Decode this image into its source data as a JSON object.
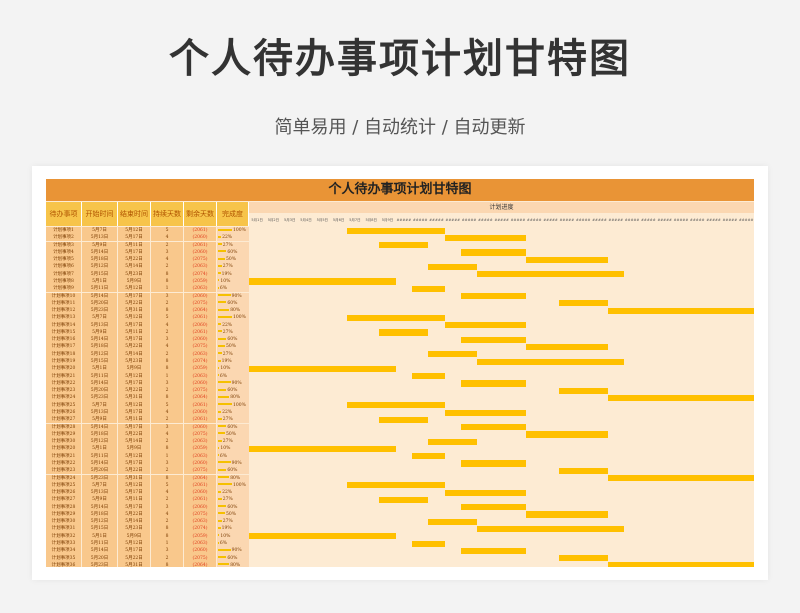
{
  "page": {
    "title": "个人待办事项计划甘特图",
    "subtitle": "简单易用 / 自动统计 / 自动更新"
  },
  "sheet": {
    "title": "个人待办事项计划甘特图",
    "headers": [
      "待办事项",
      "开始时间",
      "结束时间",
      "持续天数",
      "剩余天数",
      "完成度"
    ],
    "plan_header": "计划进度",
    "dates_visible": [
      "5月1日",
      "5月2日",
      "5月3日",
      "5月4日",
      "5月5日",
      "5月6日",
      "5月7日",
      "5月8日",
      "5月9日"
    ]
  },
  "rows": [
    {
      "name": "计划事项1",
      "start": "5月7日",
      "end": "5月12日",
      "dur": "5",
      "remain": "(2061)",
      "pct": "100%",
      "bar_start": 7,
      "bar_days": 6
    },
    {
      "name": "计划事项2",
      "start": "5月13日",
      "end": "5月17日",
      "dur": "4",
      "remain": "(2060)",
      "pct": "22%",
      "bar_start": 13,
      "bar_days": 5
    },
    {
      "name": "计划事项3",
      "start": "5月9日",
      "end": "5月11日",
      "dur": "2",
      "remain": "(2061)",
      "pct": "27%",
      "bar_start": 9,
      "bar_days": 3
    },
    {
      "name": "计划事项4",
      "start": "5月14日",
      "end": "5月17日",
      "dur": "3",
      "remain": "(2060)",
      "pct": "60%",
      "bar_start": 14,
      "bar_days": 4
    },
    {
      "name": "计划事项5",
      "start": "5月18日",
      "end": "5月22日",
      "dur": "4",
      "remain": "(2075)",
      "pct": "50%",
      "bar_start": 18,
      "bar_days": 5
    },
    {
      "name": "计划事项6",
      "start": "5月12日",
      "end": "5月14日",
      "dur": "2",
      "remain": "(2063)",
      "pct": "27%",
      "bar_start": 12,
      "bar_days": 3
    },
    {
      "name": "计划事项7",
      "start": "5月15日",
      "end": "5月23日",
      "dur": "8",
      "remain": "(2074)",
      "pct": "19%",
      "bar_start": 15,
      "bar_days": 9
    },
    {
      "name": "计划事项8",
      "start": "5月1日",
      "end": "5月9日",
      "dur": "8",
      "remain": "(2059)",
      "pct": "10%",
      "bar_start": 1,
      "bar_days": 9
    },
    {
      "name": "计划事项9",
      "start": "5月11日",
      "end": "5月12日",
      "dur": "1",
      "remain": "(2063)",
      "pct": "6%",
      "bar_start": 11,
      "bar_days": 2
    },
    {
      "name": "计划事项10",
      "start": "5月14日",
      "end": "5月17日",
      "dur": "3",
      "remain": "(2060)",
      "pct": "90%",
      "bar_start": 14,
      "bar_days": 4
    },
    {
      "name": "计划事项11",
      "start": "5月20日",
      "end": "5月22日",
      "dur": "2",
      "remain": "(2075)",
      "pct": "60%",
      "bar_start": 20,
      "bar_days": 3
    },
    {
      "name": "计划事项12",
      "start": "5月23日",
      "end": "5月31日",
      "dur": "8",
      "remain": "(2064)",
      "pct": "80%",
      "bar_start": 23,
      "bar_days": 9
    },
    {
      "name": "计划事项13",
      "start": "5月7日",
      "end": "5月12日",
      "dur": "5",
      "remain": "(2061)",
      "pct": "100%",
      "bar_start": 7,
      "bar_days": 6
    },
    {
      "name": "计划事项14",
      "start": "5月13日",
      "end": "5月17日",
      "dur": "4",
      "remain": "(2060)",
      "pct": "22%",
      "bar_start": 13,
      "bar_days": 5
    },
    {
      "name": "计划事项15",
      "start": "5月9日",
      "end": "5月11日",
      "dur": "2",
      "remain": "(2061)",
      "pct": "27%",
      "bar_start": 9,
      "bar_days": 3
    },
    {
      "name": "计划事项16",
      "start": "5月14日",
      "end": "5月17日",
      "dur": "3",
      "remain": "(2060)",
      "pct": "60%",
      "bar_start": 14,
      "bar_days": 4
    },
    {
      "name": "计划事项17",
      "start": "5月18日",
      "end": "5月22日",
      "dur": "4",
      "remain": "(2075)",
      "pct": "50%",
      "bar_start": 18,
      "bar_days": 5
    },
    {
      "name": "计划事项18",
      "start": "5月12日",
      "end": "5月14日",
      "dur": "2",
      "remain": "(2063)",
      "pct": "27%",
      "bar_start": 12,
      "bar_days": 3
    },
    {
      "name": "计划事项19",
      "start": "5月15日",
      "end": "5月23日",
      "dur": "8",
      "remain": "(2074)",
      "pct": "19%",
      "bar_start": 15,
      "bar_days": 9
    },
    {
      "name": "计划事项20",
      "start": "5月1日",
      "end": "5月9日",
      "dur": "8",
      "remain": "(2059)",
      "pct": "10%",
      "bar_start": 1,
      "bar_days": 9
    },
    {
      "name": "计划事项21",
      "start": "5月11日",
      "end": "5月12日",
      "dur": "1",
      "remain": "(2063)",
      "pct": "6%",
      "bar_start": 11,
      "bar_days": 2
    },
    {
      "name": "计划事项22",
      "start": "5月14日",
      "end": "5月17日",
      "dur": "3",
      "remain": "(2060)",
      "pct": "90%",
      "bar_start": 14,
      "bar_days": 4
    },
    {
      "name": "计划事项23",
      "start": "5月20日",
      "end": "5月22日",
      "dur": "2",
      "remain": "(2075)",
      "pct": "60%",
      "bar_start": 20,
      "bar_days": 3
    },
    {
      "name": "计划事项24",
      "start": "5月23日",
      "end": "5月31日",
      "dur": "8",
      "remain": "(2064)",
      "pct": "80%",
      "bar_start": 23,
      "bar_days": 9
    },
    {
      "name": "计划事项25",
      "start": "5月7日",
      "end": "5月12日",
      "dur": "5",
      "remain": "(2061)",
      "pct": "100%",
      "bar_start": 7,
      "bar_days": 6
    },
    {
      "name": "计划事项26",
      "start": "5月13日",
      "end": "5月17日",
      "dur": "4",
      "remain": "(2060)",
      "pct": "22%",
      "bar_start": 13,
      "bar_days": 5
    },
    {
      "name": "计划事项27",
      "start": "5月9日",
      "end": "5月11日",
      "dur": "2",
      "remain": "(2061)",
      "pct": "27%",
      "bar_start": 9,
      "bar_days": 3
    },
    {
      "name": "计划事项28",
      "start": "5月14日",
      "end": "5月17日",
      "dur": "3",
      "remain": "(2060)",
      "pct": "60%",
      "bar_start": 14,
      "bar_days": 4
    },
    {
      "name": "计划事项29",
      "start": "5月18日",
      "end": "5月22日",
      "dur": "4",
      "remain": "(2075)",
      "pct": "50%",
      "bar_start": 18,
      "bar_days": 5
    },
    {
      "name": "计划事项30",
      "start": "5月12日",
      "end": "5月14日",
      "dur": "2",
      "remain": "(2063)",
      "pct": "27%",
      "bar_start": 12,
      "bar_days": 3
    },
    {
      "name": "计划事项20",
      "start": "5月1日",
      "end": "5月9日",
      "dur": "8",
      "remain": "(2059)",
      "pct": "10%",
      "bar_start": 1,
      "bar_days": 9
    },
    {
      "name": "计划事项21",
      "start": "5月11日",
      "end": "5月12日",
      "dur": "1",
      "remain": "(2063)",
      "pct": "6%",
      "bar_start": 11,
      "bar_days": 2
    },
    {
      "name": "计划事项22",
      "start": "5月14日",
      "end": "5月17日",
      "dur": "3",
      "remain": "(2060)",
      "pct": "90%",
      "bar_start": 14,
      "bar_days": 4
    },
    {
      "name": "计划事项23",
      "start": "5月20日",
      "end": "5月22日",
      "dur": "2",
      "remain": "(2075)",
      "pct": "60%",
      "bar_start": 20,
      "bar_days": 3
    },
    {
      "name": "计划事项24",
      "start": "5月23日",
      "end": "5月31日",
      "dur": "8",
      "remain": "(2064)",
      "pct": "80%",
      "bar_start": 23,
      "bar_days": 9
    },
    {
      "name": "计划事项25",
      "start": "5月7日",
      "end": "5月12日",
      "dur": "5",
      "remain": "(2061)",
      "pct": "100%",
      "bar_start": 7,
      "bar_days": 6
    },
    {
      "name": "计划事项26",
      "start": "5月13日",
      "end": "5月17日",
      "dur": "4",
      "remain": "(2060)",
      "pct": "22%",
      "bar_start": 13,
      "bar_days": 5
    },
    {
      "name": "计划事项27",
      "start": "5月9日",
      "end": "5月11日",
      "dur": "2",
      "remain": "(2061)",
      "pct": "27%",
      "bar_start": 9,
      "bar_days": 3
    },
    {
      "name": "计划事项28",
      "start": "5月14日",
      "end": "5月17日",
      "dur": "3",
      "remain": "(2060)",
      "pct": "60%",
      "bar_start": 14,
      "bar_days": 4
    },
    {
      "name": "计划事项29",
      "start": "5月18日",
      "end": "5月22日",
      "dur": "4",
      "remain": "(2075)",
      "pct": "50%",
      "bar_start": 18,
      "bar_days": 5
    },
    {
      "name": "计划事项30",
      "start": "5月12日",
      "end": "5月14日",
      "dur": "2",
      "remain": "(2063)",
      "pct": "27%",
      "bar_start": 12,
      "bar_days": 3
    },
    {
      "name": "计划事项31",
      "start": "5月15日",
      "end": "5月23日",
      "dur": "8",
      "remain": "(2074)",
      "pct": "19%",
      "bar_start": 15,
      "bar_days": 9
    },
    {
      "name": "计划事项32",
      "start": "5月1日",
      "end": "5月9日",
      "dur": "8",
      "remain": "(2059)",
      "pct": "10%",
      "bar_start": 1,
      "bar_days": 9
    },
    {
      "name": "计划事项33",
      "start": "5月11日",
      "end": "5月12日",
      "dur": "1",
      "remain": "(2063)",
      "pct": "6%",
      "bar_start": 11,
      "bar_days": 2
    },
    {
      "name": "计划事项34",
      "start": "5月14日",
      "end": "5月17日",
      "dur": "3",
      "remain": "(2060)",
      "pct": "90%",
      "bar_start": 14,
      "bar_days": 4
    },
    {
      "name": "计划事项35",
      "start": "5月20日",
      "end": "5月22日",
      "dur": "2",
      "remain": "(2075)",
      "pct": "60%",
      "bar_start": 20,
      "bar_days": 3
    },
    {
      "name": "计划事项36",
      "start": "5月23日",
      "end": "5月31日",
      "dur": "8",
      "remain": "(2064)",
      "pct": "80%",
      "bar_start": 23,
      "bar_days": 9
    }
  ]
}
